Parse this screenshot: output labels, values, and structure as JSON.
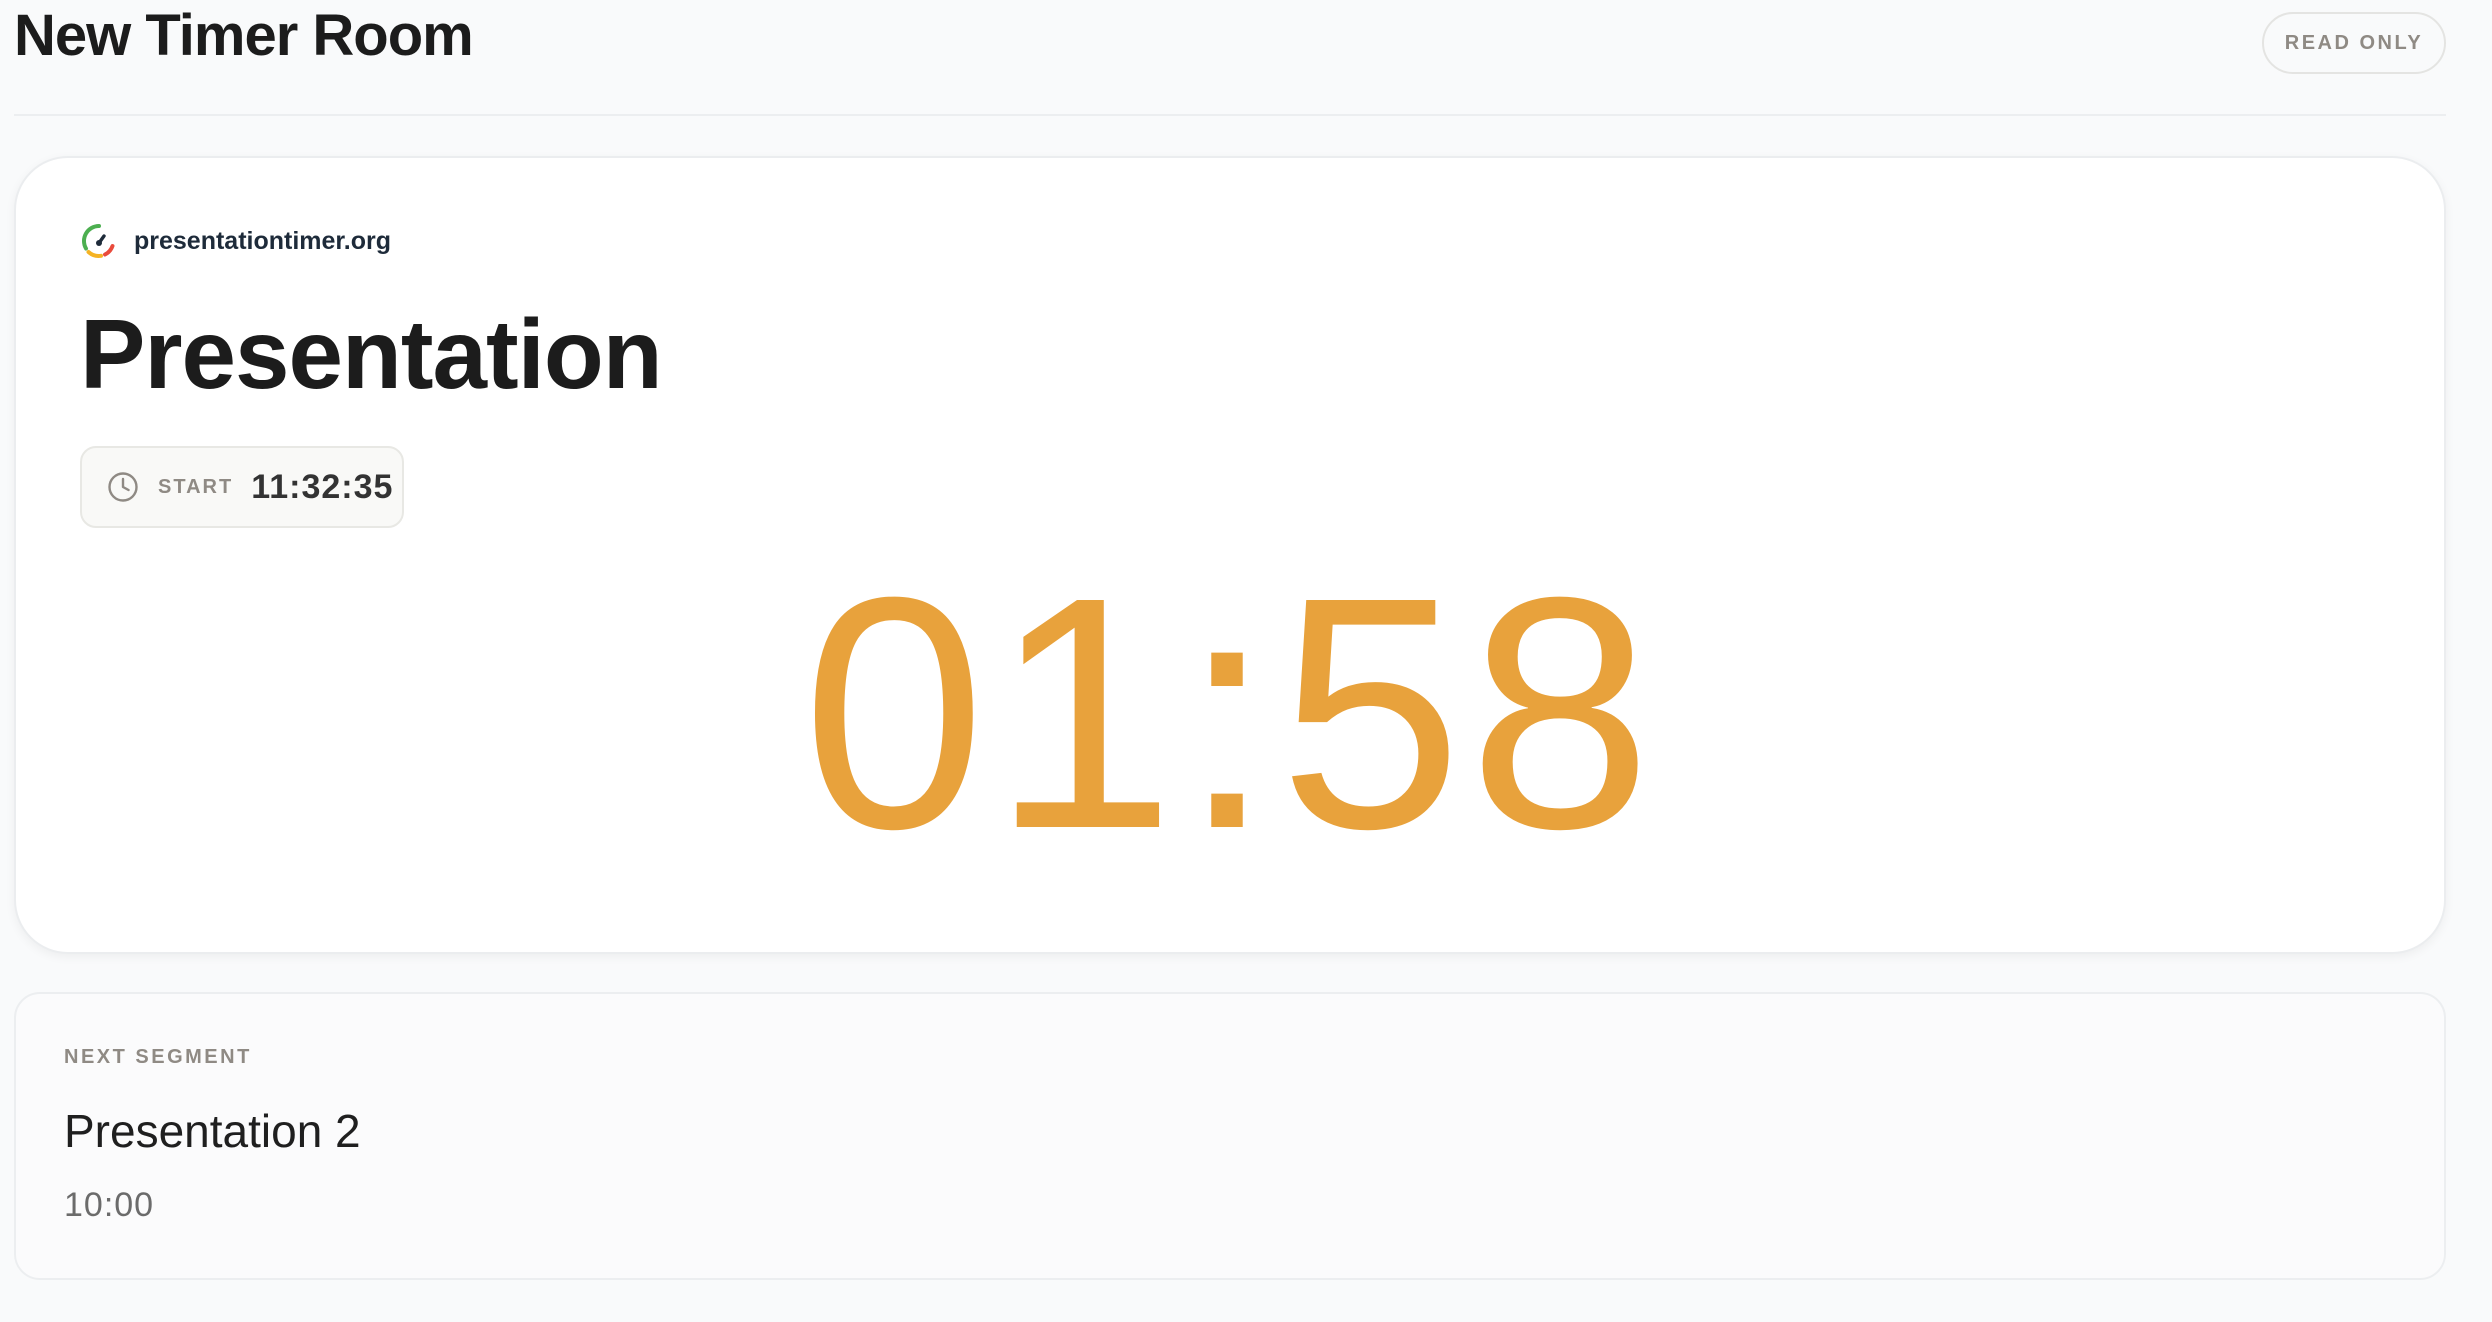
{
  "header": {
    "room_title": "New Timer Room",
    "readonly_label": "READ ONLY"
  },
  "timer": {
    "brand": {
      "name": "presentationtimer.org",
      "icon": "gauge-icon"
    },
    "segment_title": "Presentation",
    "start": {
      "icon": "clock-icon",
      "label": "START",
      "time": "11:32:35"
    },
    "countdown": "01:58",
    "countdown_color": "#e8a23c"
  },
  "next_segment": {
    "label": "NEXT SEGMENT",
    "title": "Presentation 2",
    "duration": "10:00"
  }
}
